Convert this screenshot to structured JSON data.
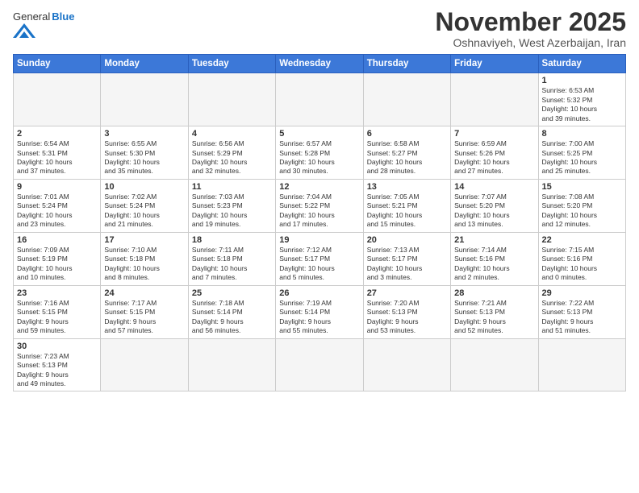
{
  "header": {
    "logo_general": "General",
    "logo_blue": "Blue",
    "month": "November 2025",
    "location": "Oshnaviyeh, West Azerbaijan, Iran"
  },
  "weekdays": [
    "Sunday",
    "Monday",
    "Tuesday",
    "Wednesday",
    "Thursday",
    "Friday",
    "Saturday"
  ],
  "weeks": [
    [
      {
        "day": "",
        "info": ""
      },
      {
        "day": "",
        "info": ""
      },
      {
        "day": "",
        "info": ""
      },
      {
        "day": "",
        "info": ""
      },
      {
        "day": "",
        "info": ""
      },
      {
        "day": "",
        "info": ""
      },
      {
        "day": "1",
        "info": "Sunrise: 6:53 AM\nSunset: 5:32 PM\nDaylight: 10 hours\nand 39 minutes."
      }
    ],
    [
      {
        "day": "2",
        "info": "Sunrise: 6:54 AM\nSunset: 5:31 PM\nDaylight: 10 hours\nand 37 minutes."
      },
      {
        "day": "3",
        "info": "Sunrise: 6:55 AM\nSunset: 5:30 PM\nDaylight: 10 hours\nand 35 minutes."
      },
      {
        "day": "4",
        "info": "Sunrise: 6:56 AM\nSunset: 5:29 PM\nDaylight: 10 hours\nand 32 minutes."
      },
      {
        "day": "5",
        "info": "Sunrise: 6:57 AM\nSunset: 5:28 PM\nDaylight: 10 hours\nand 30 minutes."
      },
      {
        "day": "6",
        "info": "Sunrise: 6:58 AM\nSunset: 5:27 PM\nDaylight: 10 hours\nand 28 minutes."
      },
      {
        "day": "7",
        "info": "Sunrise: 6:59 AM\nSunset: 5:26 PM\nDaylight: 10 hours\nand 27 minutes."
      },
      {
        "day": "8",
        "info": "Sunrise: 7:00 AM\nSunset: 5:25 PM\nDaylight: 10 hours\nand 25 minutes."
      }
    ],
    [
      {
        "day": "9",
        "info": "Sunrise: 7:01 AM\nSunset: 5:24 PM\nDaylight: 10 hours\nand 23 minutes."
      },
      {
        "day": "10",
        "info": "Sunrise: 7:02 AM\nSunset: 5:24 PM\nDaylight: 10 hours\nand 21 minutes."
      },
      {
        "day": "11",
        "info": "Sunrise: 7:03 AM\nSunset: 5:23 PM\nDaylight: 10 hours\nand 19 minutes."
      },
      {
        "day": "12",
        "info": "Sunrise: 7:04 AM\nSunset: 5:22 PM\nDaylight: 10 hours\nand 17 minutes."
      },
      {
        "day": "13",
        "info": "Sunrise: 7:05 AM\nSunset: 5:21 PM\nDaylight: 10 hours\nand 15 minutes."
      },
      {
        "day": "14",
        "info": "Sunrise: 7:07 AM\nSunset: 5:20 PM\nDaylight: 10 hours\nand 13 minutes."
      },
      {
        "day": "15",
        "info": "Sunrise: 7:08 AM\nSunset: 5:20 PM\nDaylight: 10 hours\nand 12 minutes."
      }
    ],
    [
      {
        "day": "16",
        "info": "Sunrise: 7:09 AM\nSunset: 5:19 PM\nDaylight: 10 hours\nand 10 minutes."
      },
      {
        "day": "17",
        "info": "Sunrise: 7:10 AM\nSunset: 5:18 PM\nDaylight: 10 hours\nand 8 minutes."
      },
      {
        "day": "18",
        "info": "Sunrise: 7:11 AM\nSunset: 5:18 PM\nDaylight: 10 hours\nand 7 minutes."
      },
      {
        "day": "19",
        "info": "Sunrise: 7:12 AM\nSunset: 5:17 PM\nDaylight: 10 hours\nand 5 minutes."
      },
      {
        "day": "20",
        "info": "Sunrise: 7:13 AM\nSunset: 5:17 PM\nDaylight: 10 hours\nand 3 minutes."
      },
      {
        "day": "21",
        "info": "Sunrise: 7:14 AM\nSunset: 5:16 PM\nDaylight: 10 hours\nand 2 minutes."
      },
      {
        "day": "22",
        "info": "Sunrise: 7:15 AM\nSunset: 5:16 PM\nDaylight: 10 hours\nand 0 minutes."
      }
    ],
    [
      {
        "day": "23",
        "info": "Sunrise: 7:16 AM\nSunset: 5:15 PM\nDaylight: 9 hours\nand 59 minutes."
      },
      {
        "day": "24",
        "info": "Sunrise: 7:17 AM\nSunset: 5:15 PM\nDaylight: 9 hours\nand 57 minutes."
      },
      {
        "day": "25",
        "info": "Sunrise: 7:18 AM\nSunset: 5:14 PM\nDaylight: 9 hours\nand 56 minutes."
      },
      {
        "day": "26",
        "info": "Sunrise: 7:19 AM\nSunset: 5:14 PM\nDaylight: 9 hours\nand 55 minutes."
      },
      {
        "day": "27",
        "info": "Sunrise: 7:20 AM\nSunset: 5:13 PM\nDaylight: 9 hours\nand 53 minutes."
      },
      {
        "day": "28",
        "info": "Sunrise: 7:21 AM\nSunset: 5:13 PM\nDaylight: 9 hours\nand 52 minutes."
      },
      {
        "day": "29",
        "info": "Sunrise: 7:22 AM\nSunset: 5:13 PM\nDaylight: 9 hours\nand 51 minutes."
      }
    ],
    [
      {
        "day": "30",
        "info": "Sunrise: 7:23 AM\nSunset: 5:13 PM\nDaylight: 9 hours\nand 49 minutes."
      },
      {
        "day": "",
        "info": ""
      },
      {
        "day": "",
        "info": ""
      },
      {
        "day": "",
        "info": ""
      },
      {
        "day": "",
        "info": ""
      },
      {
        "day": "",
        "info": ""
      },
      {
        "day": "",
        "info": ""
      }
    ]
  ]
}
